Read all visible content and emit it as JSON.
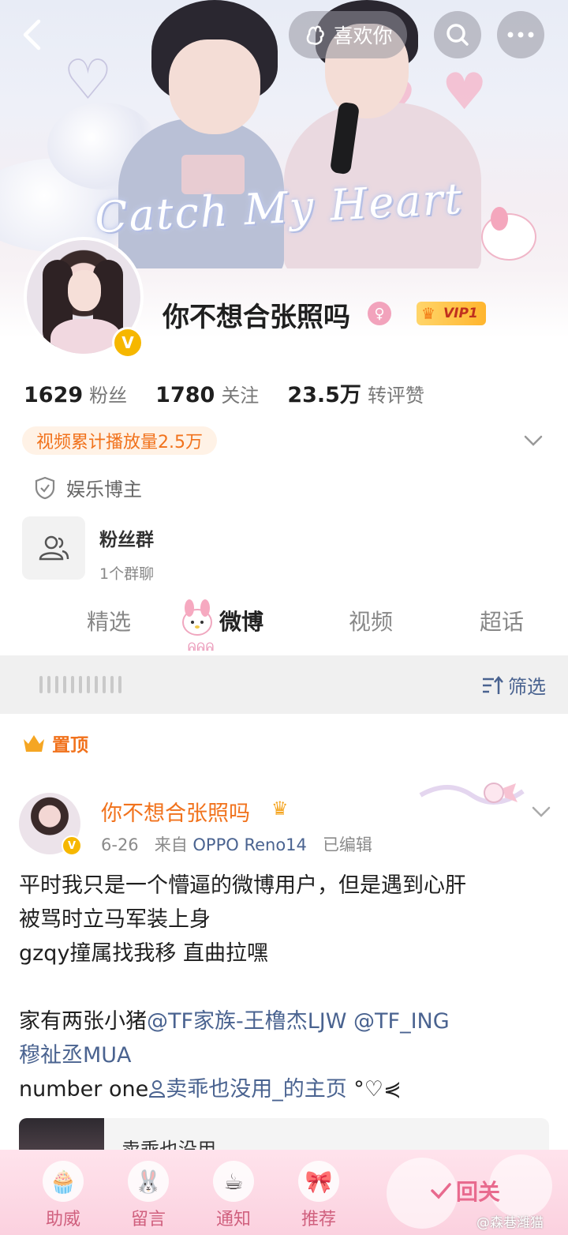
{
  "topbar": {
    "like_label": "喜欢你"
  },
  "banner": {
    "script_text": "Catch My Heart"
  },
  "profile": {
    "username": "你不想合张照吗",
    "vip_label": "VIP1",
    "stats": [
      {
        "num": "1629",
        "label": "粉丝"
      },
      {
        "num": "1780",
        "label": "关注"
      },
      {
        "num": "23.5万",
        "label": "转评赞"
      }
    ],
    "play_count": "视频累计播放量2.5万",
    "certification": "娱乐博主",
    "fan_group": {
      "title": "粉丝群",
      "subtitle": "1个群聊"
    }
  },
  "tabs": [
    {
      "label": "精选"
    },
    {
      "label": "微博"
    },
    {
      "label": "视频"
    },
    {
      "label": "超话"
    }
  ],
  "filter": {
    "label": "筛选"
  },
  "post": {
    "pin_label": "置顶",
    "author": "你不想合张照吗",
    "date": "6-26",
    "from_prefix": "来自",
    "source": "OPPO Reno14",
    "edited": "已编辑",
    "lines": {
      "l1": "平时我只是一个懵逼的微博用户，但是遇到心肝",
      "l2": "被骂时立马军装上身",
      "l3": "gzqy撞属找我移 直曲拉嘿",
      "l5a": "家有两张小猪",
      "l5b": "@TF家族-王橹杰LJW @TF_ING",
      "l6": "穆祉丞MUA",
      "l7a": "number one",
      "l7b": "卖乖也没用_的主页",
      "l7c": " °♡⋞"
    },
    "quote_title": "卖乖也没用"
  },
  "bottombar": {
    "items": [
      {
        "label": "助威"
      },
      {
        "label": "留言"
      },
      {
        "label": "通知"
      },
      {
        "label": "推荐"
      }
    ],
    "follow_label": "回关",
    "watermark": "@森巷潍猫"
  },
  "colors": {
    "accent_orange": "#f1721c",
    "link_blue": "#4a6390",
    "vip_gold": "#ffb52e",
    "pink": "#e86a8e"
  }
}
